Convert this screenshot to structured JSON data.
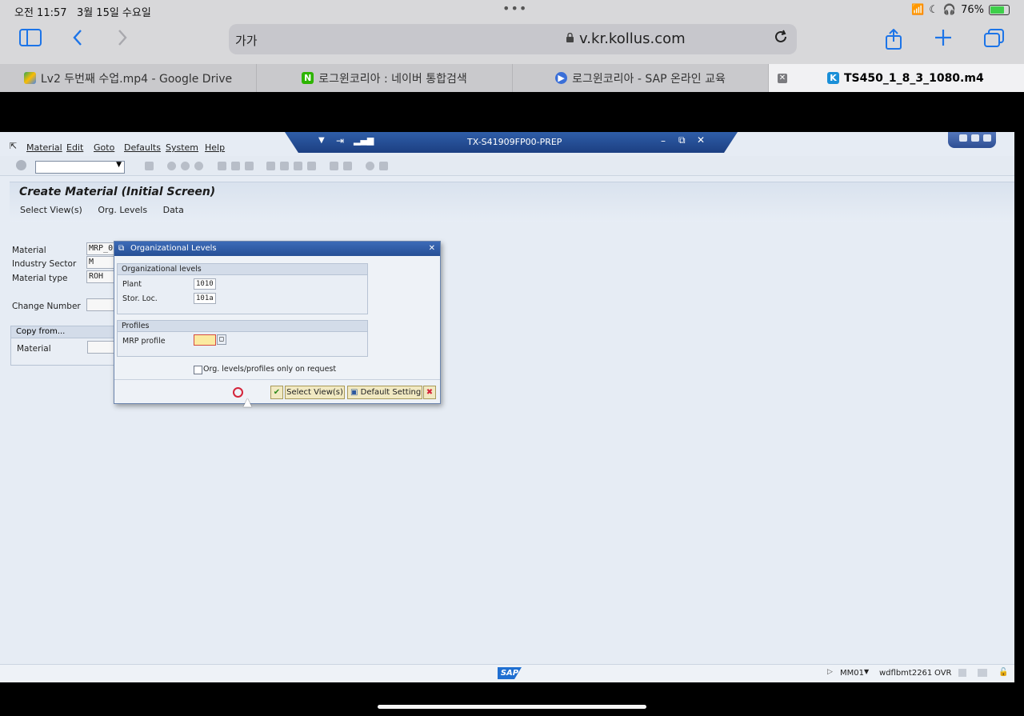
{
  "status_bar": {
    "time": "오전 11:57",
    "date": "3월 15일 수요일",
    "dots": "•••",
    "battery": "76%"
  },
  "safari": {
    "aa_label": "가가",
    "url": "v.kr.kollus.com",
    "tabs": [
      {
        "label": "Lv2 두번째 수업.mp4 - Google Drive"
      },
      {
        "label": "로그윈코리아 : 네이버 통합검색"
      },
      {
        "label": "로그윈코리아 - SAP 온라인 교육"
      },
      {
        "label": "TS450_1_8_3_1080.m4"
      }
    ],
    "icons": {
      "sidebar": "sidebar-icon",
      "back": "chevron-left-icon",
      "forward": "chevron-right-icon",
      "share": "share-icon",
      "new_tab": "plus-icon",
      "tabs": "tabs-icon",
      "reload": "reload-icon",
      "lock": "lock-icon"
    }
  },
  "sap": {
    "system_title": "TX-S41909FP00-PREP",
    "menu": [
      "Material",
      "Edit",
      "Goto",
      "Defaults",
      "System",
      "Help"
    ],
    "page_title": "Create Material (Initial Screen)",
    "app_toolbar": [
      "Select View(s)",
      "Org. Levels",
      "Data"
    ],
    "fields": {
      "material_label": "Material",
      "material_value": "MRP_0",
      "industry_label": "Industry Sector",
      "industry_value": "M Mech",
      "mtype_label": "Material type",
      "mtype_value": "ROH Ra",
      "change_label": "Change Number",
      "copy_from": "Copy from...",
      "copy_material_label": "Material"
    },
    "dialog": {
      "title": "Organizational Levels",
      "org_group": "Organizational levels",
      "plant_label": "Plant",
      "plant_value": "1010",
      "storloc_label": "Stor. Loc.",
      "storloc_value": "101a",
      "profiles_group": "Profiles",
      "mrp_label": "MRP profile",
      "mrp_value": "",
      "checkbox_label": "Org. levels/profiles only on request",
      "btn_select_views": "Select View(s)",
      "btn_default": "Default Setting"
    },
    "status": {
      "transaction": "MM01",
      "server": "wdflbmt2261",
      "mode": "OVR",
      "logo": "SAP"
    }
  }
}
